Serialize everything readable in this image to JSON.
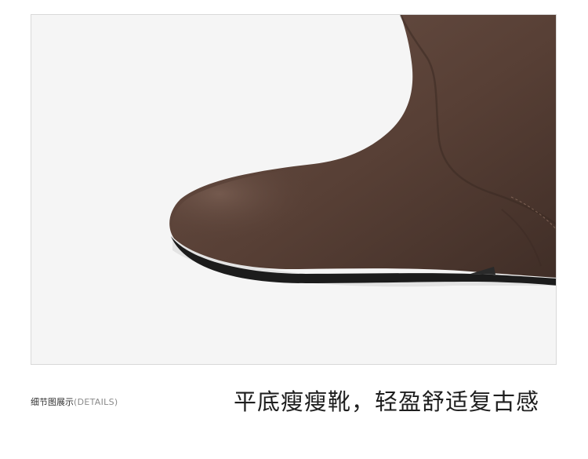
{
  "detail_section": {
    "label_cn": "细节图展示",
    "label_en": "(DETAILS)"
  },
  "headline": "平底瘦瘦靴，轻盈舒适复古感",
  "product_image": {
    "subject": "brown suede flat boot toe close-up",
    "colors": {
      "background": "#f5f5f5",
      "suede": "#5a4238",
      "suede_shadow": "#3e2c25",
      "sole": "#1c1c1c"
    }
  }
}
